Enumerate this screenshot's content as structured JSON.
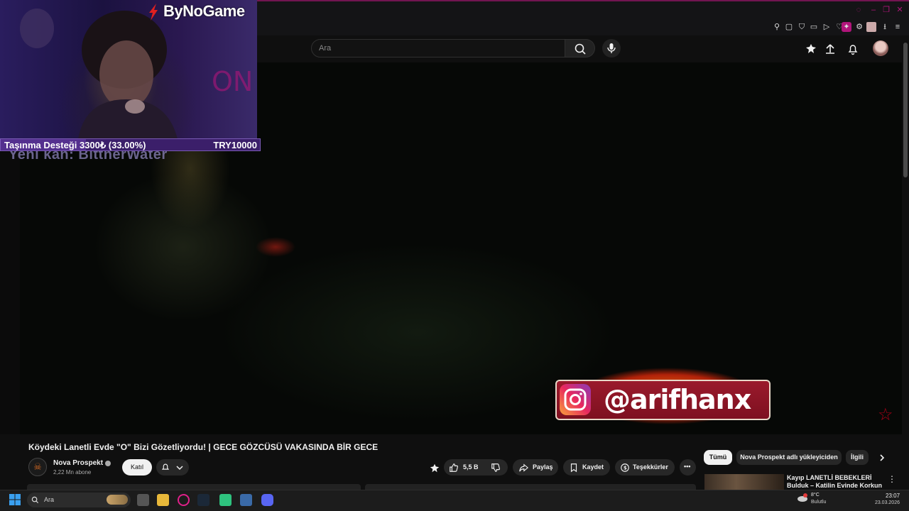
{
  "overlay": {
    "brand": "ByNoGame",
    "donation_label": "Taşınma Desteği 3300₺ (33.00%)",
    "donation_goal": "TRY10000",
    "donation_progress": 0.33,
    "new_subscriber": "Yeni kan: BittnerWater",
    "instagram_handle": "@arifhanx"
  },
  "header": {
    "search_placeholder": "Ara"
  },
  "video": {
    "title": "Köydeki Lanetli Evde \"O\" Bizi Gözetliyordu! | GECE GÖZCÜSÜ VAKASINDA BİR GECE",
    "channel_name": "Nova Prospekt",
    "subscribers": "2,22 Mn abone",
    "join_label": "Katıl",
    "like_count": "5,5 B",
    "share_label": "Paylaş",
    "save_label": "Kaydet",
    "thanks_label": "Teşekkürler"
  },
  "chips": [
    "Tümü",
    "Nova Prospekt adlı yükleyiciden",
    "İlgili"
  ],
  "related": {
    "title": "Kayıp LANETLİ BEBEKLERİ Bulduk – Katilin Evinde Korkun"
  },
  "taskbar": {
    "search_placeholder": "Ara",
    "weather_temp": "8°C",
    "weather_desc": "Bulutlu",
    "time": "23:07",
    "date": "23.03.2026"
  },
  "colors": {
    "accent_pink": "#b0157a",
    "youtube_bg": "#0f0f0f",
    "instagram_box": "#9a1a2c"
  }
}
